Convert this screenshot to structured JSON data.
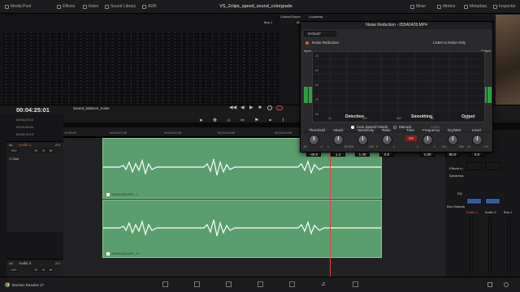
{
  "window": {
    "title": "VS_2clips_speed_sound_colorgrade",
    "app_name": "DaVinci Resolve 17"
  },
  "topbar": {
    "left_items": [
      {
        "label": "Media Pool",
        "icon": "media-pool-icon"
      },
      {
        "label": "Effects",
        "icon": "effects-icon"
      },
      {
        "label": "Index",
        "icon": "index-icon"
      },
      {
        "label": "Sound Library",
        "icon": "sound-library-icon"
      },
      {
        "label": "ADR",
        "icon": "adr-icon"
      }
    ],
    "right_items": [
      {
        "label": "Mixer",
        "icon": "mixer-icon"
      },
      {
        "label": "Meters",
        "icon": "meters-icon"
      },
      {
        "label": "Metadata",
        "icon": "metadata-icon"
      },
      {
        "label": "Inspector",
        "icon": "inspector-icon"
      }
    ]
  },
  "mixer": {
    "control_room": "Control Room",
    "loudness": "Loudness",
    "bus_label": "Bus 1",
    "m1": "M1"
  },
  "timeline": {
    "timecode": "00:04:25:01",
    "name": "Sound_balance_noise",
    "rows": [
      {
        "timecode": "00:04:20:14"
      },
      {
        "timecode": "00:04:26:04"
      },
      {
        "timecode": "00:00:10:13"
      }
    ],
    "ruler": [
      "00:04:21:00",
      "00:04:22:00",
      "00:04:23:00",
      "00:04:24:00"
    ],
    "ruler_start": "+4:20:00",
    "tracks": [
      {
        "name": "Audio 1",
        "id": "A1",
        "volume": "0.0",
        "clips_count": "1 Clips",
        "clip_name": "055A0428.MP4 - L",
        "level": "2.0"
      },
      {
        "name": "Audio 2",
        "id": "A2",
        "volume": "0.0",
        "clip_name": "055A0428.MP4 - R",
        "level": "2.0"
      }
    ]
  },
  "plugin": {
    "title": "Noise Reduction - 055A0428.MP4",
    "preset": "Default*",
    "name": "Noise Reduction",
    "listen_label": "Listen to Noise Only",
    "input_label": "Input",
    "output_label": "Output",
    "auto_speech": "Auto Speech Mode",
    "manual": "Manual",
    "learn": "Learn",
    "scale": [
      "-10",
      "-20",
      "-30",
      "-40",
      "-50",
      "-60",
      "-70",
      "-80",
      "-90",
      "-100"
    ],
    "freq_scale": [
      "20",
      "50",
      "100",
      "200",
      "500",
      "1k",
      "2k",
      "5k",
      "10k",
      "20k"
    ],
    "sections": {
      "detection": "Detection",
      "smoothing": "Smoothing",
      "output": "Output"
    },
    "knobs": [
      {
        "label": "Threshold",
        "value": "-40.0",
        "min": "-80",
        "max": "-0"
      },
      {
        "label": "Attack",
        "value": "1.4",
        "min": "1",
        "max": "50.000"
      },
      {
        "label": "Sensitivity",
        "value": "1.30",
        "min": "1",
        "max": "100"
      },
      {
        "label": "Ratio",
        "value": "0.6",
        "min": "0",
        "max": "1"
      },
      {
        "label": "Frequency",
        "value": "1.00",
        "min": "0",
        "max": "1"
      },
      {
        "label": "Dry/Wet",
        "value": "80.0",
        "min": "Dry",
        "max": "Wet"
      },
      {
        "label": "Level",
        "value": "0.0",
        "min": "-10",
        "max": "+10"
      }
    ],
    "smoothing_time": "Time",
    "smoothing_time_value": "On"
  },
  "right_panel": {
    "bus_label": "Bus 1",
    "effects_in": "Effects In",
    "dynamics": "Dynamics",
    "eq": "EQ",
    "bus_outputs": "Bus Outputs",
    "audio1": "Audio 1",
    "audio2": "Audio 2",
    "bus1": "Bus 1"
  },
  "colors": {
    "clip": "#5b9e6e",
    "playhead": "#e04040",
    "accent": "#e85a3a",
    "meter": "#2ea13f"
  }
}
